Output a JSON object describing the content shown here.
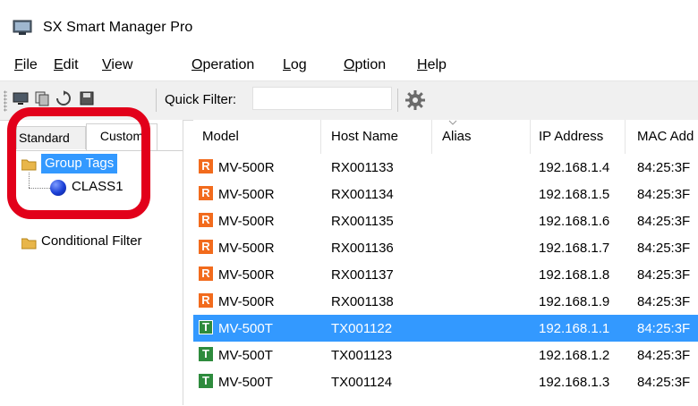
{
  "window": {
    "title": "SX Smart Manager Pro"
  },
  "menu": [
    {
      "label": "File",
      "mnemonic": "F",
      "rest": "ile"
    },
    {
      "label": "Edit",
      "mnemonic": "E",
      "rest": "dit"
    },
    {
      "label": "View",
      "mnemonic": "V",
      "rest": "iew"
    },
    {
      "label": "Operation",
      "mnemonic": "O",
      "rest": "peration"
    },
    {
      "label": "Log",
      "mnemonic": "L",
      "rest": "og"
    },
    {
      "label": "Option",
      "mnemonic": "O",
      "rest": "ption"
    },
    {
      "label": "Help",
      "mnemonic": "H",
      "rest": "elp"
    }
  ],
  "toolbar": {
    "quick_filter_label": "Quick Filter:",
    "quick_filter_value": "",
    "quick_filter_placeholder": "",
    "icons": [
      "display-icon",
      "copy-icon",
      "refresh-icon",
      "save-icon",
      "settings-gear-icon"
    ]
  },
  "left_panel": {
    "tabs": [
      {
        "label": "Standard",
        "active": false
      },
      {
        "label": "Custom",
        "active": true
      }
    ],
    "tree": {
      "group_tags": "Group Tags",
      "class_item": "CLASS1",
      "conditional_filter": "Conditional Filter"
    }
  },
  "table": {
    "columns": [
      "Model",
      "Host Name",
      "Alias",
      "IP Address",
      "MAC Add"
    ],
    "rows": [
      {
        "type": "R",
        "model": "MV-500R",
        "host": "RX001133",
        "alias": "",
        "ip": "192.168.1.4",
        "mac": "84:25:3F",
        "selected": false
      },
      {
        "type": "R",
        "model": "MV-500R",
        "host": "RX001134",
        "alias": "",
        "ip": "192.168.1.5",
        "mac": "84:25:3F",
        "selected": false
      },
      {
        "type": "R",
        "model": "MV-500R",
        "host": "RX001135",
        "alias": "",
        "ip": "192.168.1.6",
        "mac": "84:25:3F",
        "selected": false
      },
      {
        "type": "R",
        "model": "MV-500R",
        "host": "RX001136",
        "alias": "",
        "ip": "192.168.1.7",
        "mac": "84:25:3F",
        "selected": false
      },
      {
        "type": "R",
        "model": "MV-500R",
        "host": "RX001137",
        "alias": "",
        "ip": "192.168.1.8",
        "mac": "84:25:3F",
        "selected": false
      },
      {
        "type": "R",
        "model": "MV-500R",
        "host": "RX001138",
        "alias": "",
        "ip": "192.168.1.9",
        "mac": "84:25:3F",
        "selected": false
      },
      {
        "type": "T",
        "model": "MV-500T",
        "host": "TX001122",
        "alias": "",
        "ip": "192.168.1.1",
        "mac": "84:25:3F",
        "selected": true
      },
      {
        "type": "T",
        "model": "MV-500T",
        "host": "TX001123",
        "alias": "",
        "ip": "192.168.1.2",
        "mac": "84:25:3F",
        "selected": false
      },
      {
        "type": "T",
        "model": "MV-500T",
        "host": "TX001124",
        "alias": "",
        "ip": "192.168.1.3",
        "mac": "84:25:3F",
        "selected": false
      }
    ]
  },
  "colors": {
    "selection": "#3399ff",
    "receiver_badge": "#f26b1d",
    "transmitter_badge": "#2e8b3d",
    "annotation_ring": "#e2001a"
  }
}
